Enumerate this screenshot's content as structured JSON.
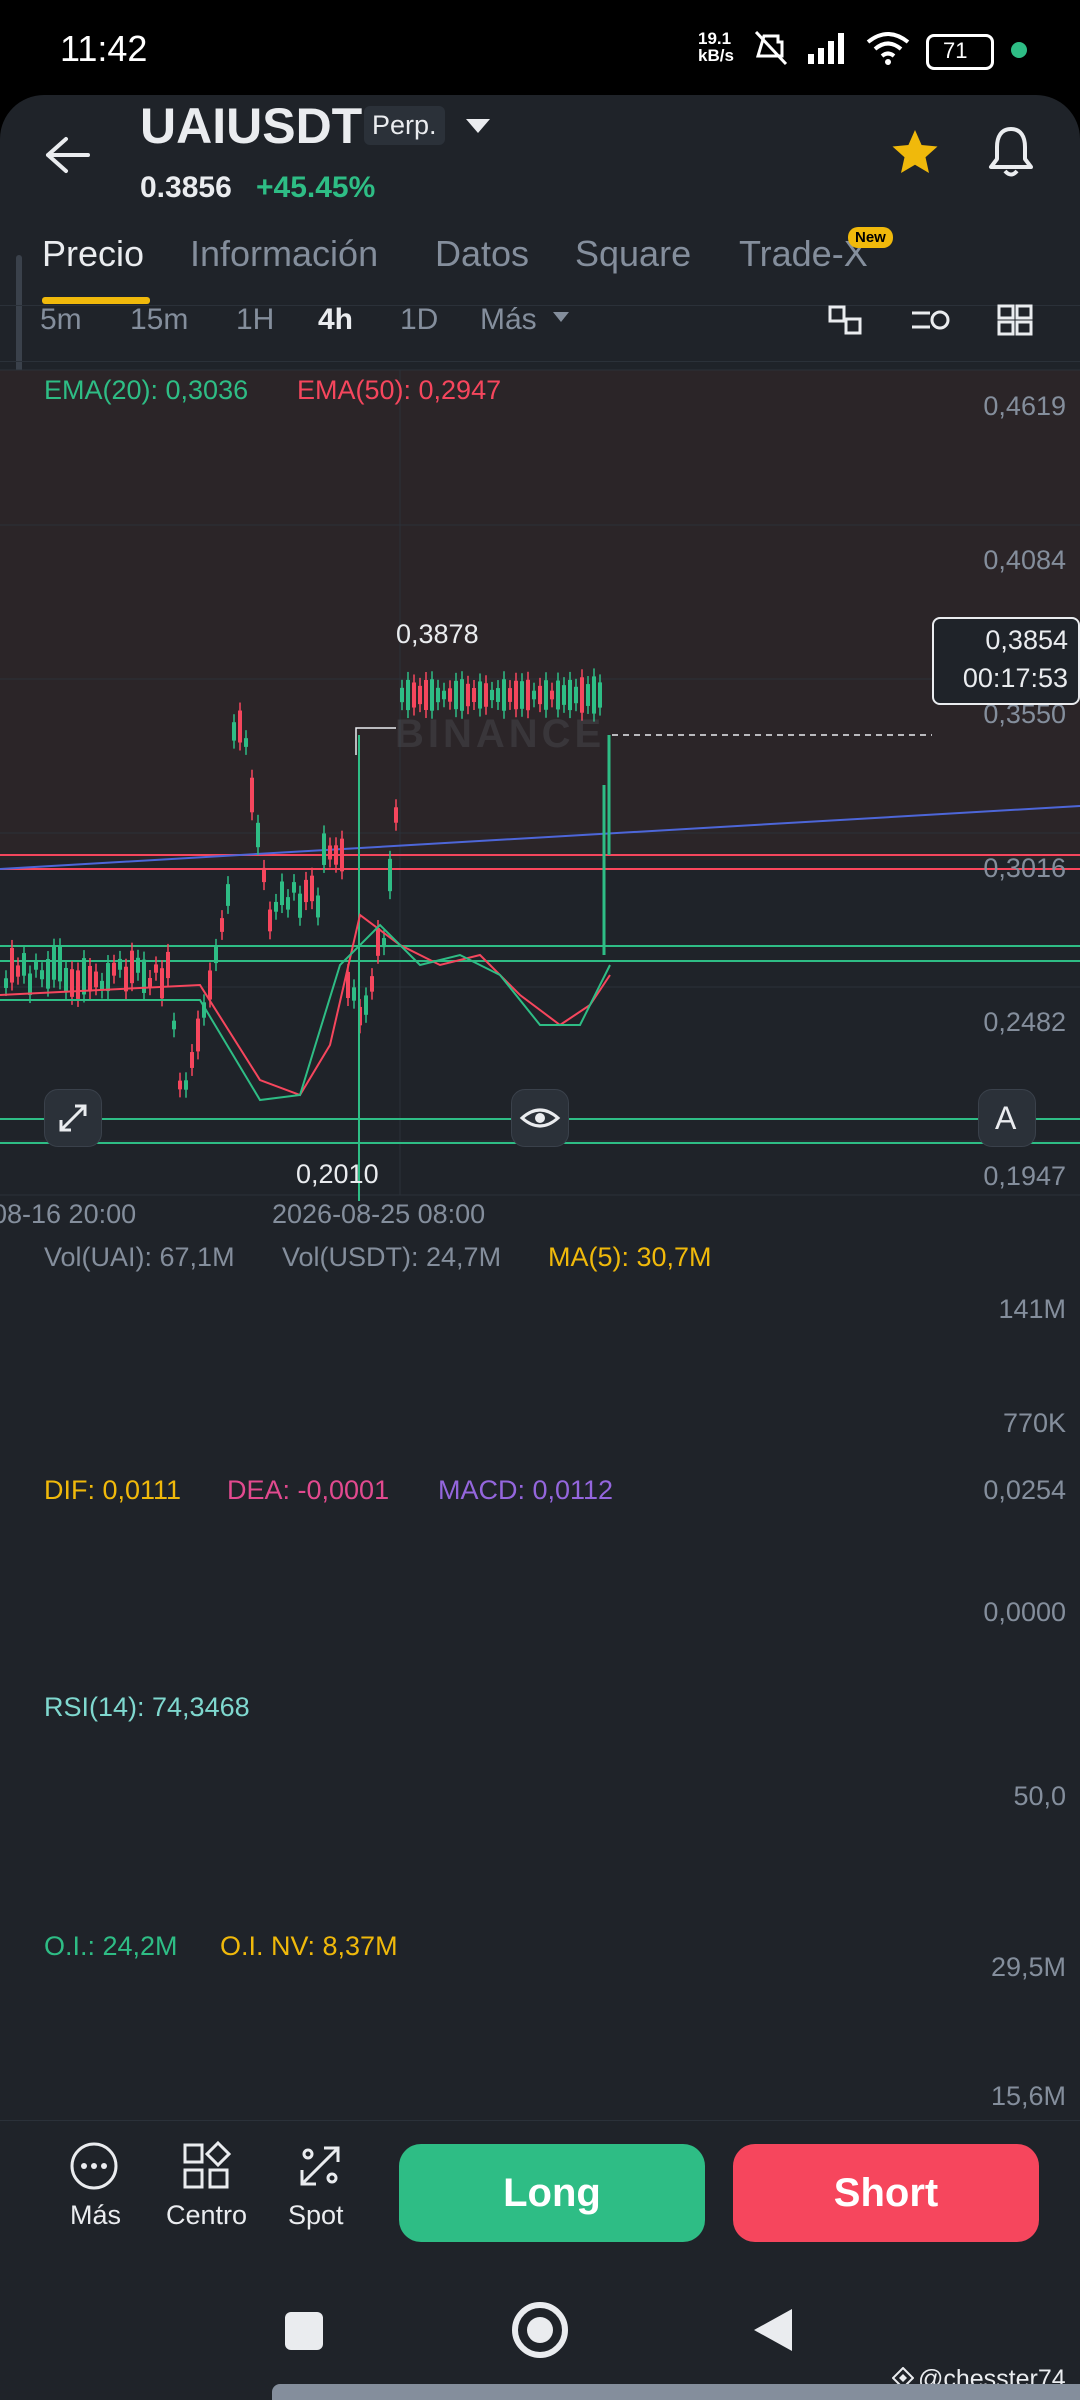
{
  "status_bar": {
    "time": "11:42",
    "net_speed_value": "19.1",
    "net_speed_unit": "kB/s",
    "battery": "71"
  },
  "header": {
    "symbol": "UAIUSDT",
    "contract_type": "Perp.",
    "price": "0.3856",
    "change": "+45.45%"
  },
  "tabs": [
    "Precio",
    "Información",
    "Datos",
    "Square",
    "Trade-X"
  ],
  "tab_badge": "New",
  "timeframes": [
    "5m",
    "15m",
    "1H",
    "4h",
    "1D",
    "Más"
  ],
  "active_timeframe": "4h",
  "indicators": {
    "ema20": "EMA(20): 0,3036",
    "ema50": "EMA(50): 0,2947"
  },
  "price_axis": [
    "0,4619",
    "0,4084",
    "0,3550",
    "0,3016",
    "0,2482",
    "0,1947"
  ],
  "price_labels": {
    "high": "0,3878",
    "low": "0,2010",
    "current": "0,3854",
    "countdown": "00:17:53",
    "auto_label": "A"
  },
  "watermark": "BINANCE",
  "time_axis": [
    "08-16 20:00",
    "2026-08-25 08:00"
  ],
  "volume": {
    "vol_uai": "Vol(UAI): 67,1M",
    "vol_usdt": "Vol(USDT): 24,7M",
    "ma5": "MA(5): 30,7M",
    "axis_top": "141M",
    "axis_bottom": "770K"
  },
  "macd": {
    "dif": "DIF: 0,0111",
    "dea": "DEA: -0,0001",
    "macd": "MACD: 0,0112",
    "axis_top": "0,0254",
    "axis_mid": "0,0000"
  },
  "rsi": {
    "label": "RSI(14): 74,3468",
    "axis_mid": "50,0"
  },
  "open_interest": {
    "oi": "O.I.: 24,2M",
    "oi_nv": "O.I. NV: 8,37M",
    "axis_top": "29,5M",
    "axis_bottom": "15,6M"
  },
  "bottom_bar": {
    "more": "Más",
    "center": "Centro",
    "spot": "Spot",
    "long": "Long",
    "short": "Short"
  },
  "username": "@chesster74",
  "colors": {
    "green": "#2ebd85",
    "red": "#f6465d",
    "yellow": "#f0b90b",
    "pink": "#e24a8f",
    "purple": "#9466dd",
    "rsi_line": "#7fd8cf",
    "blue_trendline": "#4d66d9",
    "background": "#1f2329"
  }
}
